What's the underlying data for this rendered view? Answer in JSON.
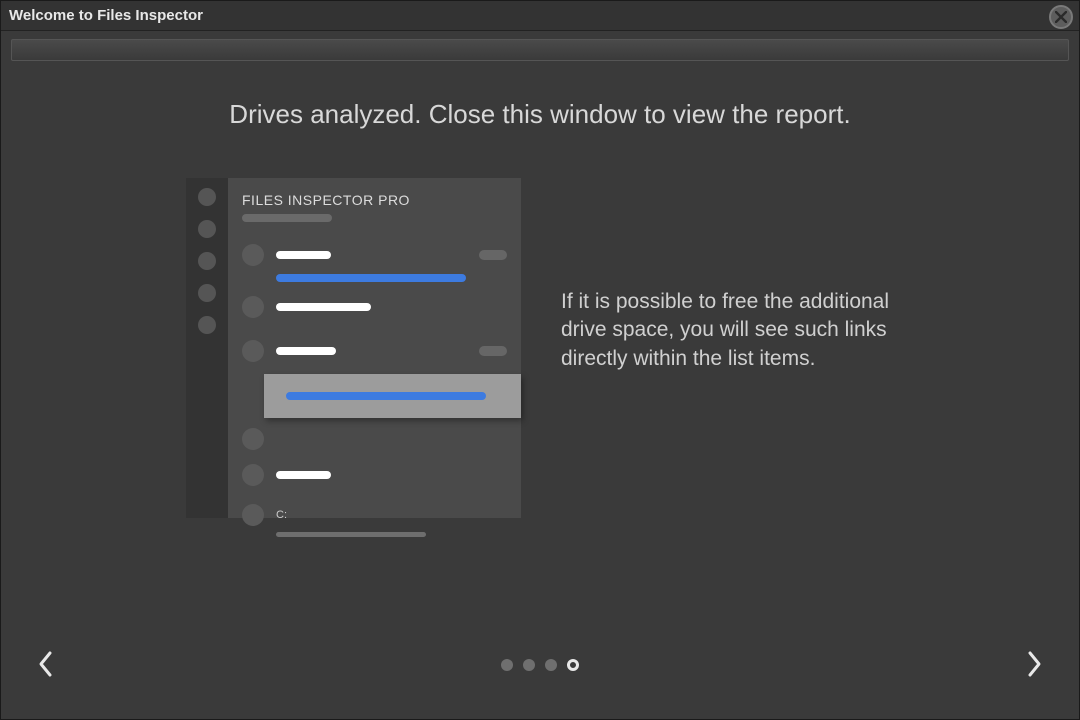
{
  "window": {
    "title": "Welcome to Files Inspector"
  },
  "slide": {
    "headline": "Drives analyzed. Close this window to view the report.",
    "explain": "If it is possible to free the additional drive space, you will see such links directly within the list items."
  },
  "mock": {
    "title": "FILES INSPECTOR PRO",
    "drive_label": "C:"
  },
  "pager": {
    "total": 4,
    "active_index": 3
  }
}
